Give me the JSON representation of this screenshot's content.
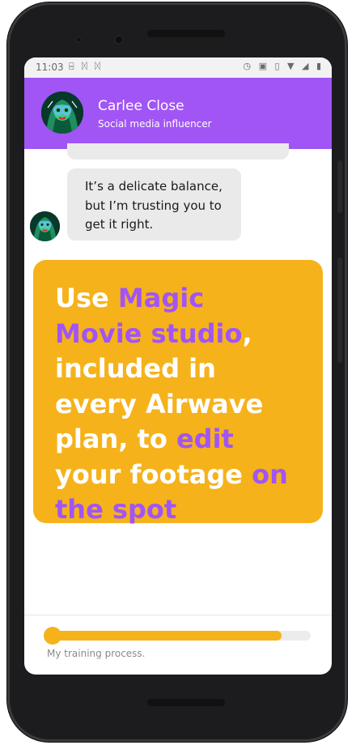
{
  "status_bar": {
    "time": "11:03",
    "left_icons": [
      "sim-icon",
      "data-icon",
      "data-icon"
    ],
    "left_icon_glyphs": "⌸ ᛞ ᛞ",
    "right_icons": [
      "alarm-icon",
      "cast-icon",
      "vibrate-icon",
      "wifi-icon",
      "signal-icon",
      "battery-icon"
    ],
    "right_icon_glyphs": "◷ ▣ ▯ ▼ ◢ ▮"
  },
  "chat_header": {
    "name": "Carlee Close",
    "subtitle": "Social media influencer",
    "background_color": "#a155f5"
  },
  "messages": [
    {
      "from": "Carlee Close",
      "text": "It’s a delicate balance, but I’m trusting you to get it right."
    }
  ],
  "promo_card": {
    "background_color": "#f5b21b",
    "highlight_color": "#a155f5",
    "parts": [
      {
        "text": "Use ",
        "highlight": false
      },
      {
        "text": "Magic Movie studio",
        "highlight": true
      },
      {
        "text": ", included in every Airwave plan, to ",
        "highlight": false
      },
      {
        "text": "edit",
        "highlight": true
      },
      {
        "text": " your footage ",
        "highlight": false
      },
      {
        "text": "on the spot",
        "highlight": true
      }
    ]
  },
  "training_progress": {
    "label": "My training process.",
    "fraction": 0.89,
    "color": "#f5b21b"
  }
}
